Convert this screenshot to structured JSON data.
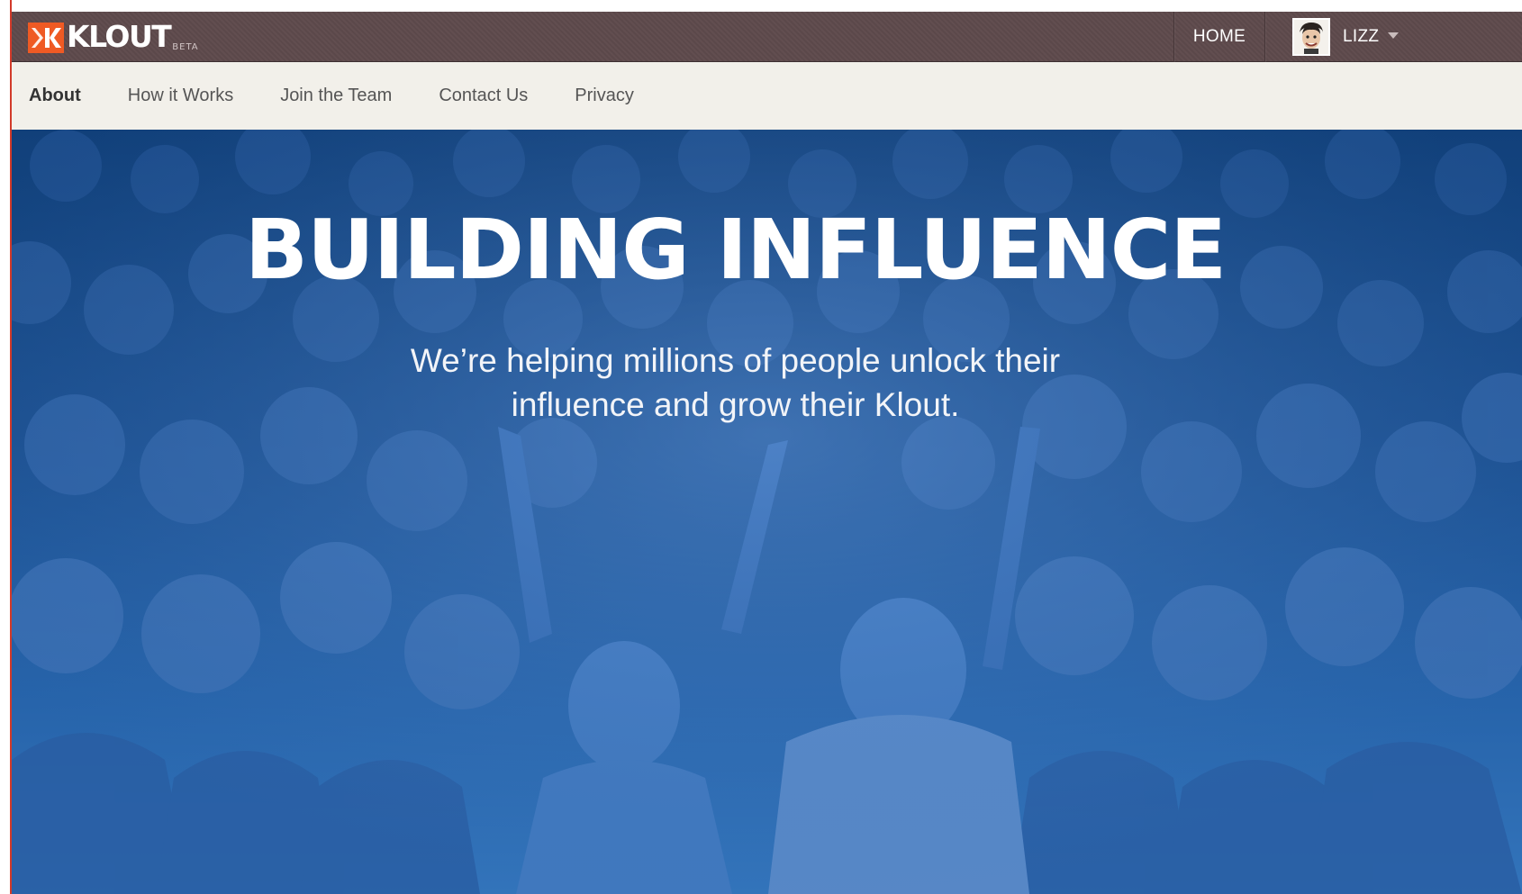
{
  "brand": {
    "name": "KLOUT",
    "tag": "BETA",
    "mark_letter": "K",
    "mark_color": "#ef5a24"
  },
  "topnav": {
    "home_label": "HOME",
    "user_name": "LIZZ"
  },
  "subnav": {
    "items": [
      {
        "label": "About",
        "active": true
      },
      {
        "label": "How it Works"
      },
      {
        "label": "Join the Team"
      },
      {
        "label": "Contact Us"
      },
      {
        "label": "Privacy"
      }
    ]
  },
  "hero": {
    "title": "BUILDING INFLUENCE",
    "subtitle_line1": "We’re helping millions of people unlock their",
    "subtitle_line2": "influence and grow their Klout.",
    "overlay_color": "#1a4f8f"
  },
  "colors": {
    "topbar": "#5e4a4c",
    "subnav_bg": "#f2f0ea"
  }
}
